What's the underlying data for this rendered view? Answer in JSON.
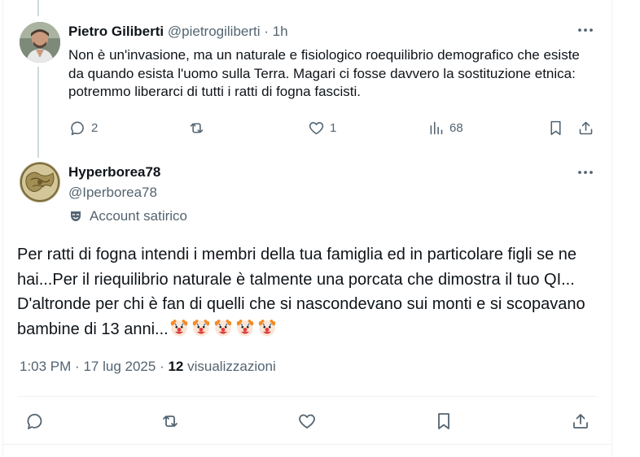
{
  "reply": {
    "name": "Pietro Giliberti",
    "handle": "@pietrogiliberti",
    "separator": "·",
    "time": "1h",
    "text": "Non è un'invasione, ma un naturale e fisiologico roequilibrio demografico che esiste da quando esista l'uomo sulla Terra. Magari ci fosse davvero la sostituzione etnica: potremmo liberarci di tutti i ratti di fogna fascisti.",
    "actions": {
      "replies": "2",
      "retweets": "",
      "likes": "1",
      "views": "68"
    }
  },
  "main": {
    "name": "Hyperborea78",
    "handle": "@Iperborea78",
    "label": "Account satirico",
    "text": "Per ratti di fogna intendi i membri della tua famiglia ed in particolare figli se ne hai...Per il riequilibrio naturale è talmente una porcata che dimostra il tuo QI... D'altronde per chi è fan di quelli che si nascondevano sui monti e si scopavano bambine di 13 anni...",
    "emoji": [
      "clown-face",
      "clown-face",
      "clown-face",
      "clown-face",
      "clown-face"
    ],
    "meta_time": "1:03 PM",
    "meta_sep1": "·",
    "meta_date": "17 lug 2025",
    "meta_sep2": "·",
    "views_count": "12",
    "views_label": "visualizzazioni"
  },
  "colors": {
    "text": "#0f1419",
    "muted": "#536471",
    "border": "#eff3f4",
    "thread": "#cfd9de"
  },
  "icons": [
    "reply-icon",
    "retweet-icon",
    "like-icon",
    "views-icon",
    "bookmark-icon",
    "share-icon",
    "more-icon",
    "satire-mask-icon"
  ]
}
